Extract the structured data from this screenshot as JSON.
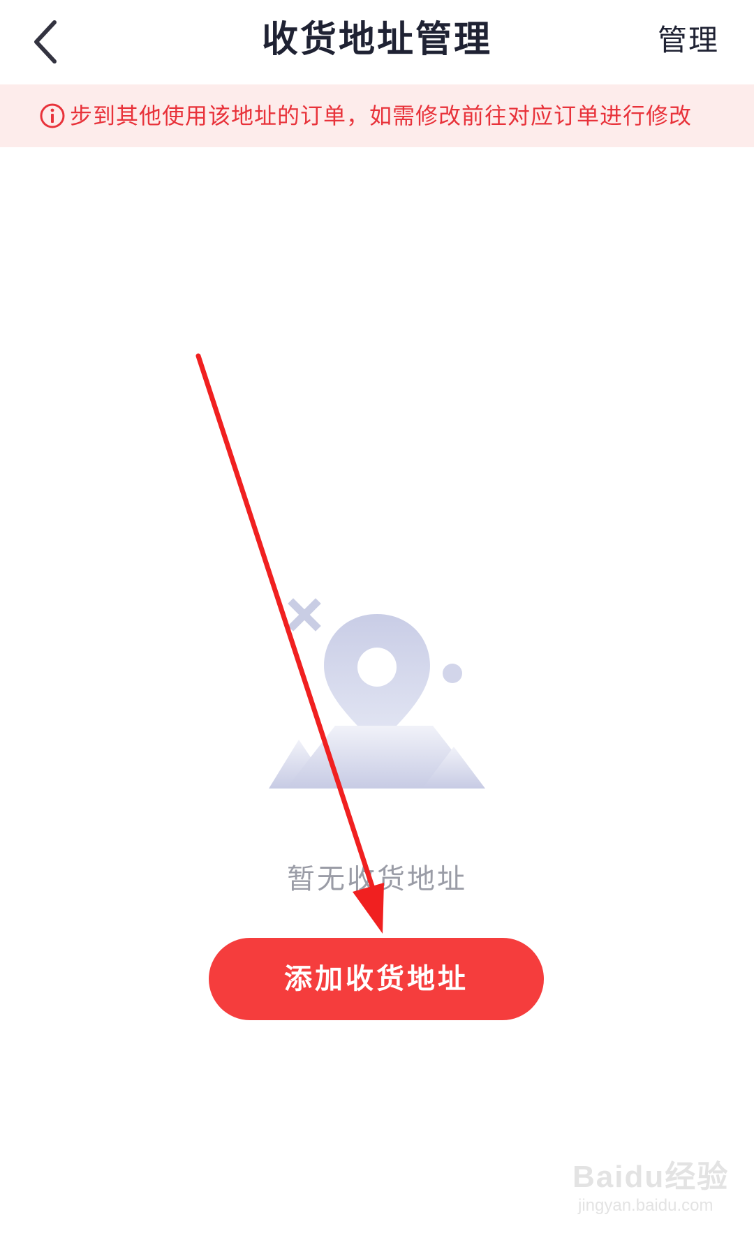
{
  "header": {
    "title": "收货地址管理",
    "manage_label": "管理"
  },
  "notice": {
    "text": "步到其他使用该地址的订单，如需修改前往对应订单进行修改",
    "color": "#e8323a",
    "background": "#fdeceb"
  },
  "empty_state": {
    "text": "暂无收货地址"
  },
  "actions": {
    "add_address_label": "添加收货地址",
    "button_color": "#f53d3d"
  },
  "watermark": {
    "logo_text": "Baidu经验",
    "url": "jingyan.baidu.com"
  }
}
